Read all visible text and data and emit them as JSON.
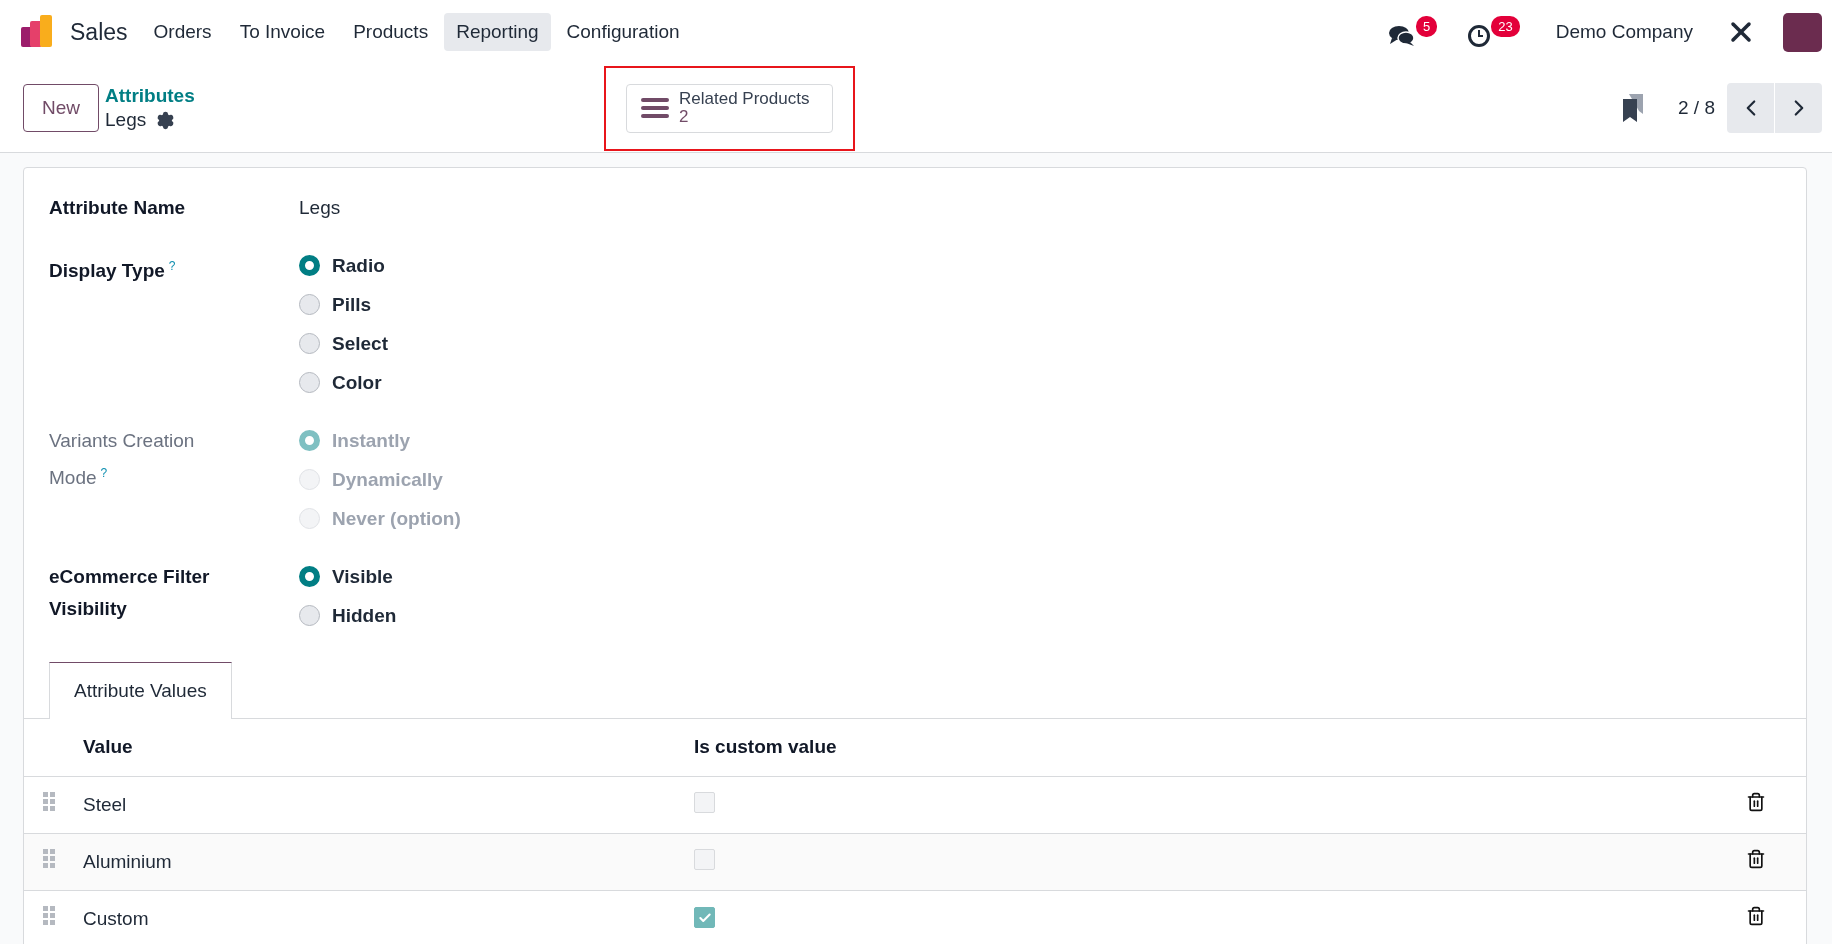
{
  "navbar": {
    "app": "Sales",
    "menus": [
      {
        "label": "Orders",
        "selected": false
      },
      {
        "label": "To Invoice",
        "selected": false
      },
      {
        "label": "Products",
        "selected": false
      },
      {
        "label": "Reporting",
        "selected": true
      },
      {
        "label": "Configuration",
        "selected": false
      }
    ],
    "notifications": [
      {
        "kind": "messages",
        "count": "5"
      },
      {
        "kind": "activities",
        "count": "23"
      }
    ],
    "company": "Demo Company"
  },
  "control_panel": {
    "new_button": "New",
    "breadcrumb": "Attributes",
    "record": "Legs",
    "smart_button": {
      "label": "Related Products",
      "count": "2",
      "highlighted": true
    },
    "pager": "2 / 8"
  },
  "form": {
    "fields": [
      {
        "label": "Attribute Name",
        "kind": "text",
        "disabled": false,
        "value": "Legs"
      },
      {
        "label": "Display Type",
        "help": "?",
        "kind": "radio",
        "disabled": false,
        "options": [
          {
            "label": "Radio",
            "selected": true
          },
          {
            "label": "Pills",
            "selected": false
          },
          {
            "label": "Select",
            "selected": false
          },
          {
            "label": "Color",
            "selected": false
          }
        ]
      },
      {
        "label": "Variants Creation Mode",
        "help": "?",
        "kind": "radio",
        "disabled": true,
        "options": [
          {
            "label": "Instantly",
            "selected": true
          },
          {
            "label": "Dynamically",
            "selected": false
          },
          {
            "label": "Never (option)",
            "selected": false
          }
        ]
      },
      {
        "label": "eCommerce Filter Visibility",
        "kind": "radio",
        "disabled": false,
        "options": [
          {
            "label": "Visible",
            "selected": true
          },
          {
            "label": "Hidden",
            "selected": false
          }
        ]
      }
    ]
  },
  "tabs": [
    {
      "label": "Attribute Values",
      "selected": true
    }
  ],
  "table": {
    "columns": [
      "Value",
      "Is custom value"
    ],
    "rows": [
      {
        "value": "Steel",
        "is_custom": false
      },
      {
        "value": "Aluminium",
        "is_custom": false
      },
      {
        "value": "Custom",
        "is_custom": true
      }
    ]
  }
}
